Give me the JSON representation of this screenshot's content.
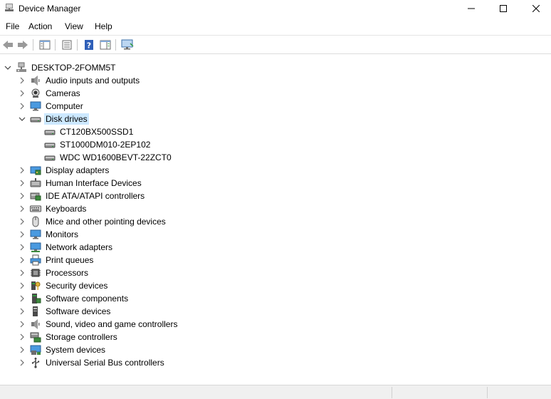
{
  "window": {
    "title": "Device Manager"
  },
  "menu": [
    {
      "label": "File"
    },
    {
      "label": "Action"
    },
    {
      "label": "View"
    },
    {
      "label": "Help"
    }
  ],
  "toolbar": {
    "buttons": [
      {
        "name": "back-button",
        "icon": "arrow-left-icon"
      },
      {
        "name": "forward-button",
        "icon": "arrow-right-icon"
      },
      {
        "name": "show-hide-console-tree-button",
        "icon": "console-tree-icon"
      },
      {
        "name": "properties-button",
        "icon": "properties-icon"
      },
      {
        "name": "help-button",
        "icon": "help-icon"
      },
      {
        "name": "action-pane-button",
        "icon": "action-pane-icon"
      },
      {
        "name": "scan-hardware-button",
        "icon": "monitor-scan-icon"
      }
    ]
  },
  "tree": {
    "root": {
      "label": "DESKTOP-2FOMM5T",
      "expanded": true,
      "icon": "computer-network-icon"
    },
    "categories": [
      {
        "label": "Audio inputs and outputs",
        "icon": "speaker-icon",
        "expanded": false
      },
      {
        "label": "Cameras",
        "icon": "camera-icon",
        "expanded": false
      },
      {
        "label": "Computer",
        "icon": "monitor-icon",
        "expanded": false
      },
      {
        "label": "Disk drives",
        "icon": "disk-drive-icon",
        "expanded": true,
        "selected": true,
        "children": [
          {
            "label": "CT120BX500SSD1",
            "icon": "disk-drive-icon"
          },
          {
            "label": "ST1000DM010-2EP102",
            "icon": "disk-drive-icon"
          },
          {
            "label": "WDC WD1600BEVT-22ZCT0",
            "icon": "disk-drive-icon"
          }
        ]
      },
      {
        "label": "Display adapters",
        "icon": "display-adapter-icon",
        "expanded": false
      },
      {
        "label": "Human Interface Devices",
        "icon": "hid-icon",
        "expanded": false
      },
      {
        "label": "IDE ATA/ATAPI controllers",
        "icon": "ide-controller-icon",
        "expanded": false
      },
      {
        "label": "Keyboards",
        "icon": "keyboard-icon",
        "expanded": false
      },
      {
        "label": "Mice and other pointing devices",
        "icon": "mouse-icon",
        "expanded": false
      },
      {
        "label": "Monitors",
        "icon": "monitor-icon",
        "expanded": false
      },
      {
        "label": "Network adapters",
        "icon": "network-adapter-icon",
        "expanded": false
      },
      {
        "label": "Print queues",
        "icon": "printer-icon",
        "expanded": false
      },
      {
        "label": "Processors",
        "icon": "processor-icon",
        "expanded": false
      },
      {
        "label": "Security devices",
        "icon": "security-key-icon",
        "expanded": false
      },
      {
        "label": "Software components",
        "icon": "software-component-icon",
        "expanded": false
      },
      {
        "label": "Software devices",
        "icon": "software-device-icon",
        "expanded": false
      },
      {
        "label": "Sound, video and game controllers",
        "icon": "speaker-icon",
        "expanded": false
      },
      {
        "label": "Storage controllers",
        "icon": "storage-controller-icon",
        "expanded": false
      },
      {
        "label": "System devices",
        "icon": "system-device-icon",
        "expanded": false
      },
      {
        "label": "Universal Serial Bus controllers",
        "icon": "usb-icon",
        "expanded": false
      }
    ]
  },
  "colors": {
    "selection": "#cce8ff",
    "icon_blue": "#2f78c4",
    "icon_gray": "#6d6d6d"
  }
}
